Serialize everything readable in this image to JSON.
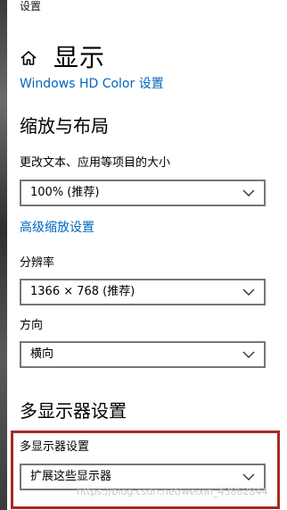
{
  "window": {
    "title": "设置"
  },
  "header": {
    "title": "显示",
    "home_icon": "home-icon"
  },
  "links": {
    "hd_color": "Windows HD Color 设置",
    "advanced_scaling": "高级缩放设置"
  },
  "scale_layout": {
    "section_title": "缩放与布局",
    "text_size_label": "更改文本、应用等项目的大小",
    "text_size_value": "100% (推荐)",
    "resolution_label": "分辨率",
    "resolution_value": "1366 × 768 (推荐)",
    "orientation_label": "方向",
    "orientation_value": "横向"
  },
  "multi_display": {
    "section_title": "多显示器设置",
    "label": "多显示器设置",
    "value": "扩展这些显示器"
  },
  "watermark": "https://blog.csdn.net/weixin_43862844",
  "colors": {
    "accent": "#0067c0",
    "highlight_border": "#a52a22",
    "dropdown_border": "#767676"
  }
}
